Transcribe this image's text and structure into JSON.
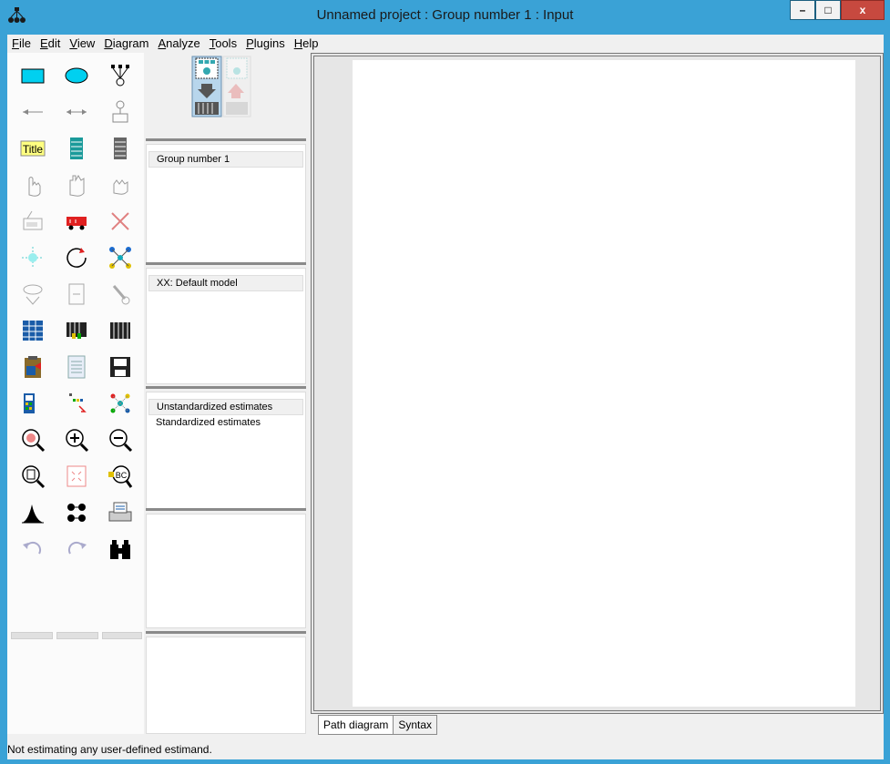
{
  "window": {
    "title": "Unnamed project : Group number 1 : Input",
    "controls": {
      "minimize": "–",
      "maximize": "□",
      "close": "x"
    }
  },
  "menu": [
    {
      "label": "File",
      "ul": "F",
      "rest": "ile"
    },
    {
      "label": "Edit",
      "ul": "E",
      "rest": "dit"
    },
    {
      "label": "View",
      "ul": "V",
      "rest": "iew"
    },
    {
      "label": "Diagram",
      "ul": "D",
      "rest": "iagram"
    },
    {
      "label": "Analyze",
      "ul": "A",
      "rest": "nalyze"
    },
    {
      "label": "Tools",
      "ul": "T",
      "rest": "ools"
    },
    {
      "label": "Plugins",
      "ul": "P",
      "rest": "lugins"
    },
    {
      "label": "Help",
      "ul": "H",
      "rest": "elp"
    }
  ],
  "toolbox": {
    "title_tool_text": "Title",
    "tools": [
      "rectangle-tool-icon",
      "ellipse-tool-icon",
      "indicator-variable-icon",
      "single-arrow-icon",
      "double-arrow-icon",
      "unique-variable-icon",
      "title-tool-icon",
      "list-variables-in-model-icon",
      "list-variables-in-dataset-icon",
      "select-one-object-icon",
      "select-all-objects-icon",
      "deselect-all-icon",
      "duplicate-objects-icon",
      "move-objects-icon",
      "erase-objects-icon",
      "change-shape-icon",
      "rotate-indicators-icon",
      "reflect-indicators-icon",
      "move-parameter-icon",
      "scroll-icon",
      "touch-up-icon",
      "select-data-files-icon",
      "analysis-properties-icon",
      "calculate-estimates-icon",
      "copy-to-clipboard-icon",
      "view-text-icon",
      "save-diagram-icon",
      "object-properties-icon",
      "drag-properties-icon",
      "preserve-symmetries-icon",
      "zoom-selected-icon",
      "zoom-in-icon",
      "zoom-out-icon",
      "view-page-icon",
      "fit-to-page-icon",
      "loupe-icon",
      "bayesian-estimation-icon",
      "multiple-group-analysis-icon",
      "print-diagram-icon",
      "undo-icon",
      "redo-icon",
      "specification-search-icon"
    ]
  },
  "panels": {
    "groups": {
      "header": "Group number 1"
    },
    "models": {
      "header": "XX: Default model"
    },
    "estimates": {
      "selected": "Unstandardized estimates",
      "other": "Standardized estimates"
    }
  },
  "tabs": {
    "path_diagram": "Path diagram",
    "syntax": "Syntax"
  },
  "status": {
    "text": "Not estimating any user-defined estimand."
  },
  "colors": {
    "titlebar": "#3aa2d6",
    "accent_cyan": "#00d0f0",
    "title_yellow": "#ffff80"
  }
}
